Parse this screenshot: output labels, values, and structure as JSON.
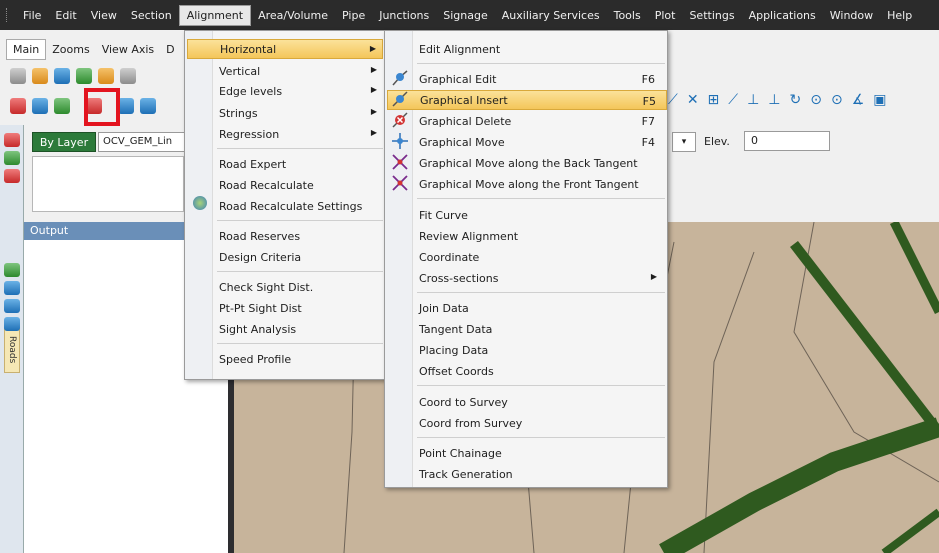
{
  "menubar": {
    "items": [
      "File",
      "Edit",
      "View",
      "Section",
      "Alignment",
      "Area/Volume",
      "Pipe",
      "Junctions",
      "Signage",
      "Auxiliary Services",
      "Tools",
      "Plot",
      "Settings",
      "Applications",
      "Window",
      "Help"
    ],
    "active": "Alignment"
  },
  "tabs": [
    "Main",
    "Zooms",
    "View Axis",
    "D"
  ],
  "layer": {
    "button": "By Layer",
    "name": "OCV_GEM_Lin"
  },
  "elevation": {
    "label": "Elev.",
    "value": "0"
  },
  "sidebar": {
    "roads_label": "Roads"
  },
  "output": {
    "title": "Output"
  },
  "alignment_menu": {
    "items": [
      {
        "label": "Horizontal",
        "submenu": true,
        "highlighted": true
      },
      {
        "label": "Vertical",
        "submenu": true
      },
      {
        "label": "Edge levels",
        "submenu": true
      },
      {
        "label": "Strings",
        "submenu": true
      },
      {
        "label": "Regression",
        "submenu": true
      },
      {
        "label": "Road Expert"
      },
      {
        "label": "Road Recalculate",
        "icon": "road-recalculate-icon"
      },
      {
        "label": "Road Recalculate Settings"
      },
      {
        "label": "Road Reserves"
      },
      {
        "label": "Design Criteria"
      },
      {
        "label": "Check Sight Dist."
      },
      {
        "label": "Pt-Pt Sight Dist"
      },
      {
        "label": "Sight Analysis"
      },
      {
        "label": "Speed Profile"
      }
    ]
  },
  "horizontal_submenu": {
    "items": [
      {
        "label": "Edit Alignment"
      },
      {
        "label": "Graphical Edit",
        "shortcut": "F6",
        "icon": "graphical-edit-icon"
      },
      {
        "label": "Graphical Insert",
        "shortcut": "F5",
        "icon": "graphical-insert-icon",
        "highlighted": true
      },
      {
        "label": "Graphical Delete",
        "shortcut": "F7",
        "icon": "graphical-delete-icon"
      },
      {
        "label": "Graphical Move",
        "shortcut": "F4",
        "icon": "graphical-move-icon"
      },
      {
        "label": "Graphical Move along the Back Tangent",
        "icon": "move-back-tangent-icon"
      },
      {
        "label": "Graphical Move along the Front Tangent",
        "icon": "move-front-tangent-icon"
      },
      {
        "label": "Fit Curve"
      },
      {
        "label": "Review Alignment"
      },
      {
        "label": "Coordinate"
      },
      {
        "label": "Cross-sections",
        "submenu": true
      },
      {
        "label": "Join Data"
      },
      {
        "label": "Tangent Data"
      },
      {
        "label": "Placing Data"
      },
      {
        "label": "Offset Coords"
      },
      {
        "label": "Coord to Survey"
      },
      {
        "label": "Coord from Survey"
      },
      {
        "label": "Point Chainage"
      },
      {
        "label": "Track Generation"
      }
    ]
  },
  "colors": {
    "menubar_bg": "#2b2b2b",
    "highlight": "#f4c65a",
    "map_bg": "#c7b49b",
    "road_green": "#2f5a1f",
    "by_layer_green": "#2c7a3a",
    "toolbar_highlight_box": "#e3141f"
  }
}
